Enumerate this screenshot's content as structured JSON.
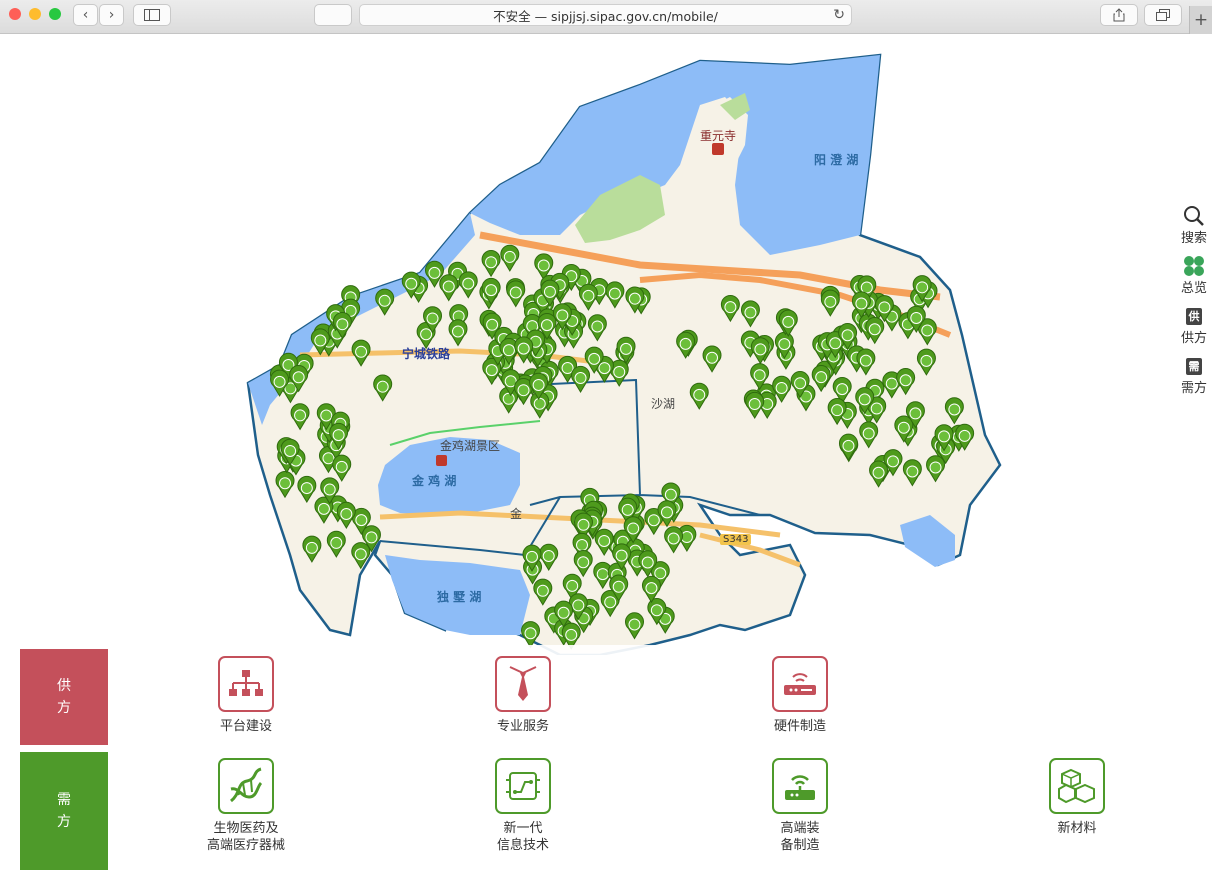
{
  "browser": {
    "url": "不安全 — sipjjsj.sipac.gov.cn/mobile/",
    "traffic_lights": [
      "#fe5f57",
      "#febc2e",
      "#28c840"
    ]
  },
  "map": {
    "labels": {
      "chongyuan": "重元寺",
      "yangcheng": "阳 澄 湖",
      "railway": "宁城铁路",
      "shahu": "沙湖",
      "jinji_scenic": "金鸡湖景区",
      "jinji": "金 鸡 湖",
      "jin": "金",
      "dushu": "独 墅 湖",
      "s343": "S343"
    },
    "colors": {
      "water": "#8dbcf7",
      "land": "#f6f2e7",
      "border": "#1f5f8b",
      "marker": "#4e9a1c",
      "road": "#f5a05a",
      "green": "#b9dd9b"
    }
  },
  "toolbar": {
    "items": [
      {
        "label": "搜索",
        "icon": "search-icon"
      },
      {
        "label": "总览",
        "icon": "clover-icon"
      },
      {
        "label": "供方",
        "icon": "supply-icon",
        "badge": "供"
      },
      {
        "label": "需方",
        "icon": "demand-icon",
        "badge": "需"
      }
    ]
  },
  "panel": {
    "supply": {
      "line1": "供",
      "line2": "方",
      "color": "#c4505b"
    },
    "demand": {
      "line1": "需",
      "line2": "方",
      "color": "#4e9a2a"
    },
    "supply_items": [
      {
        "label": "平台建设",
        "icon": "network-icon"
      },
      {
        "label": "专业服务",
        "icon": "tie-icon"
      },
      {
        "label": "硬件制造",
        "icon": "router-icon"
      }
    ],
    "demand_items": [
      {
        "line1": "生物医药及",
        "line2": "高端医疗器械",
        "icon": "dna-icon"
      },
      {
        "line1": "新一代",
        "line2": "信息技术",
        "icon": "circuit-icon"
      },
      {
        "line1": "高端装",
        "line2": "备制造",
        "icon": "equipment-icon"
      },
      {
        "line1": "新材料",
        "line2": "",
        "icon": "cubes-icon"
      }
    ]
  }
}
